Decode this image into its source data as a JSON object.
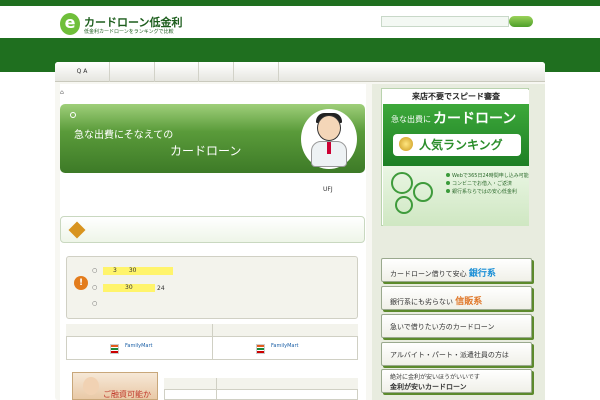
{
  "header": {
    "logo_mark": "e",
    "logo_title": "カードローン低金利",
    "logo_subtitle": "低金利カードローンをランキングで比較"
  },
  "nav": {
    "items": [
      {
        "label": "Q A"
      },
      {
        "label": ""
      },
      {
        "label": ""
      },
      {
        "label": ""
      },
      {
        "label": ""
      }
    ]
  },
  "breadcrumb": {
    "home_icon": "home-icon"
  },
  "banner": {
    "line1": "急な出費にそなえての",
    "line2": "カードローン"
  },
  "main": {
    "small_text": "UFJ",
    "bullets": [
      {
        "marker": "○",
        "highlight": "3　　30",
        "note": ""
      },
      {
        "marker": "○",
        "highlight": "30",
        "note": "24"
      },
      {
        "marker": "○",
        "highlight": "",
        "note": ""
      }
    ],
    "stores": [
      {
        "brand1": "7",
        "brand2": "FamilyMart"
      },
      {
        "brand1": "7",
        "brand2": "FamilyMart"
      }
    ],
    "photo_caption": "ご融資可能か"
  },
  "sidebar": {
    "ad": {
      "top": "来店不要でスピード審査",
      "line1": "急な出費に",
      "line2": "カードローン",
      "rank": "人気ランキング",
      "features": [
        "Webで365日24時間申し込み可能",
        "コンビニでお借入・ご返済",
        "銀行系ならではの安心低金利"
      ]
    },
    "buttons": [
      {
        "prefix": "カードローン借りて安心",
        "accent": "銀行系",
        "accent_color": "#1a8fd6"
      },
      {
        "prefix": "銀行系にも劣らない",
        "accent": "信販系",
        "accent_color": "#e0782a"
      },
      {
        "prefix": "急いで借りたい方のカードローン",
        "accent": "",
        "accent_color": "#333333"
      },
      {
        "prefix": "アルバイト・パート・派遣社員の方は",
        "accent": "",
        "accent_color": "#333333"
      }
    ],
    "last_button": {
      "line1": "絶対に金利が安いほうがいいです",
      "line2": "金利が安いカードローン"
    }
  },
  "colors": {
    "brand_green": "#1f6f1f",
    "accent_yellow": "#fff46b",
    "warning_orange": "#e37c1c"
  }
}
